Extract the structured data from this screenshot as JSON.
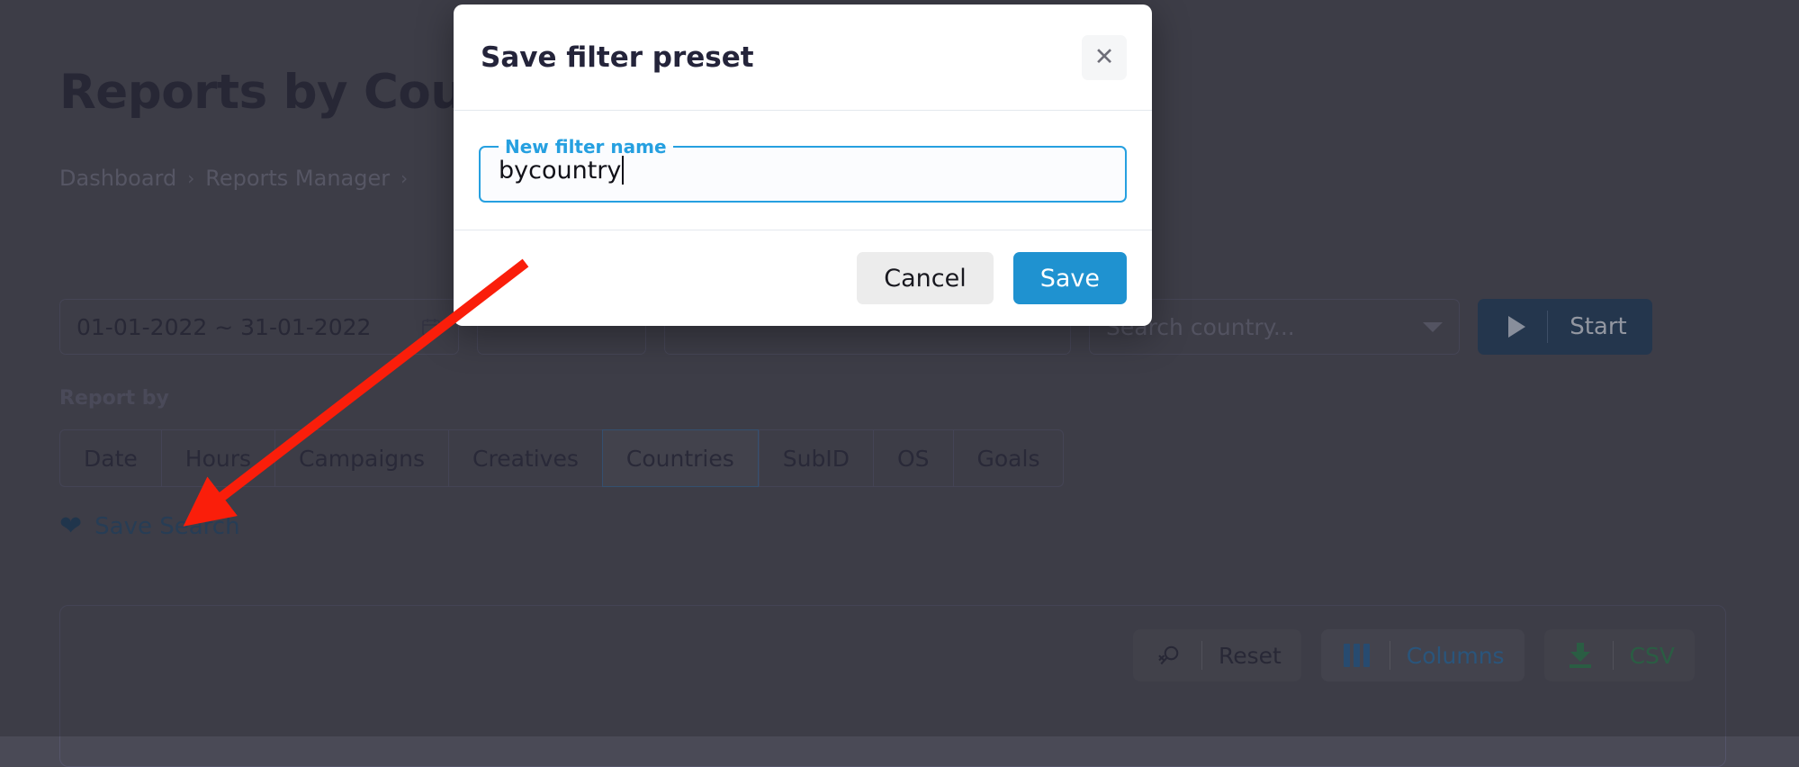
{
  "page": {
    "title": "Reports by Country",
    "breadcrumb": {
      "items": [
        "Dashboard",
        "Reports Manager",
        ""
      ],
      "separator": "›"
    },
    "filters": {
      "date_range": "01-01-2022 ~ 31-01-2022",
      "date_icon": "calendar-icon",
      "country_placeholder": "Search country...",
      "start_label": "Start",
      "start_icon": "play-icon"
    },
    "report_by": {
      "label": "Report by",
      "tabs": [
        {
          "label": "Date",
          "active": false
        },
        {
          "label": "Hours",
          "active": false
        },
        {
          "label": "Campaigns",
          "active": false
        },
        {
          "label": "Creatives",
          "active": false
        },
        {
          "label": "Countries",
          "active": true
        },
        {
          "label": "SubID",
          "active": false
        },
        {
          "label": "OS",
          "active": false
        },
        {
          "label": "Goals",
          "active": false
        }
      ]
    },
    "save_search": {
      "label": "Save Search",
      "icon": "heart-icon"
    },
    "table_toolbar": {
      "reset_label": "Reset",
      "reset_icon": "search-remove-icon",
      "columns_label": "Columns",
      "columns_icon": "columns-icon",
      "csv_label": "CSV",
      "csv_icon": "download-icon"
    }
  },
  "modal": {
    "title": "Save filter preset",
    "close_icon": "close-icon",
    "field": {
      "label": "New filter name",
      "value": "bycountry"
    },
    "cancel_label": "Cancel",
    "save_label": "Save"
  },
  "colors": {
    "overlay": "#4a4a56",
    "accent_blue": "#26a0e0",
    "save_button": "#1f92d0",
    "cancel_button": "#ececec",
    "annotation_arrow": "#fa1e0a",
    "csv_green": "#2f7a50",
    "columns_blue": "#2f6da3",
    "start_button": "#25405f"
  }
}
